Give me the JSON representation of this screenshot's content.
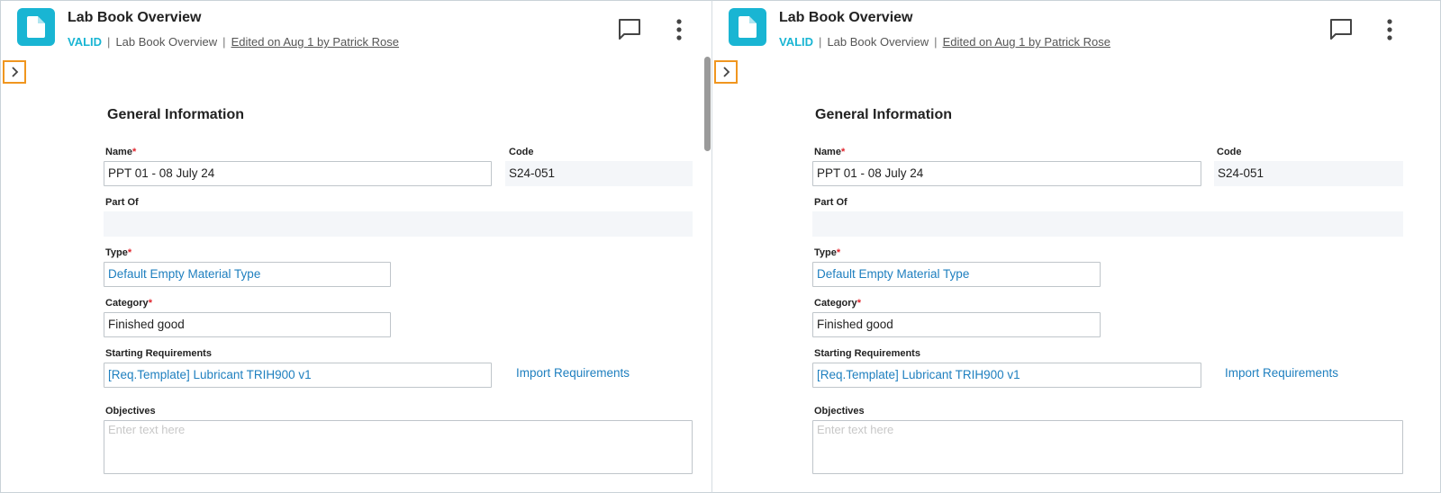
{
  "header": {
    "title": "Lab Book Overview",
    "status": "VALID",
    "separator": "|",
    "breadcrumb": "Lab Book Overview",
    "edited": "Edited on Aug 1 by Patrick Rose"
  },
  "form": {
    "section_title": "General Information",
    "required_mark": "*",
    "name": {
      "label": "Name",
      "value": "PPT 01 - 08 July 24"
    },
    "code": {
      "label": "Code",
      "value": "S24-051"
    },
    "part_of": {
      "label": "Part Of",
      "value": ""
    },
    "type": {
      "label": "Type",
      "value": "Default Empty Material Type"
    },
    "category": {
      "label": "Category",
      "value": "Finished good"
    },
    "starting_requirements": {
      "label": "Starting Requirements",
      "value": "[Req.Template] Lubricant TRIH900 v1"
    },
    "import_requirements": "Import Requirements",
    "objectives": {
      "label": "Objectives",
      "placeholder": "Enter text here"
    }
  },
  "icons": {
    "document": "document-icon",
    "comment": "comment-icon",
    "more": "more-vertical-icon",
    "expand": "chevron-right-icon"
  },
  "colors": {
    "accent": "#19b5d3",
    "link": "#1e7fbf",
    "required": "#e0252d",
    "highlight": "#f0961f"
  }
}
